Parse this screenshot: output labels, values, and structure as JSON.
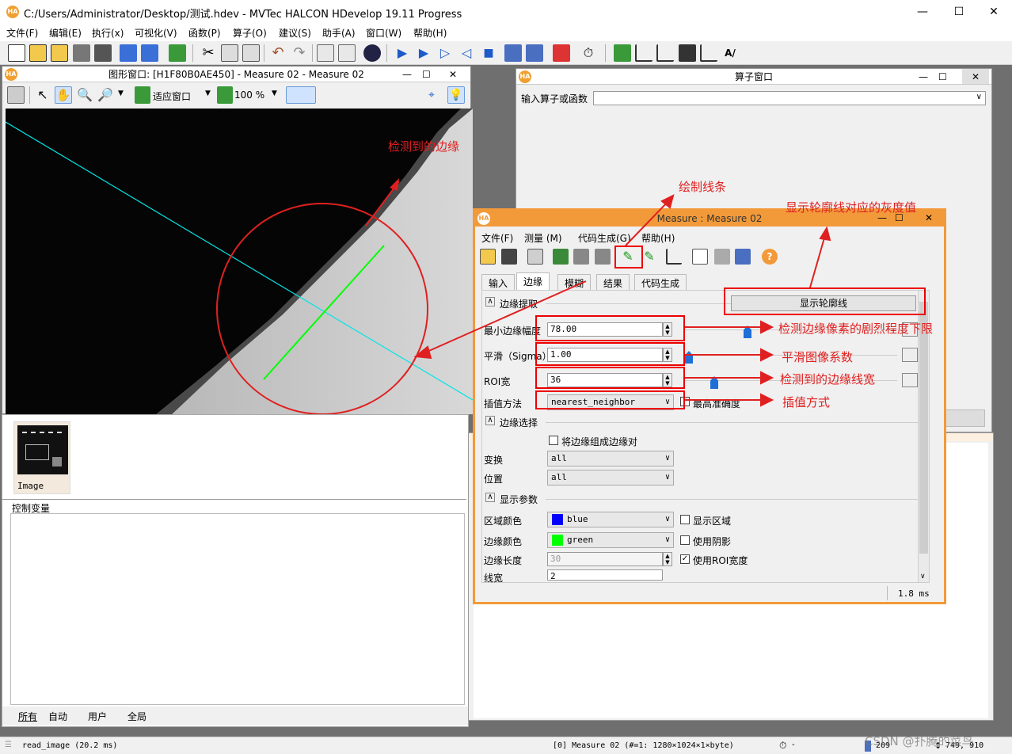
{
  "window": {
    "title": "C:/Users/Administrator/Desktop/测试.hdev - MVTec HALCON HDevelop 19.11 Progress",
    "icon": "HA"
  },
  "menu": [
    "文件(F)",
    "编辑(E)",
    "执行(x)",
    "可视化(V)",
    "函数(P)",
    "算子(O)",
    "建议(S)",
    "助手(A)",
    "窗口(W)",
    "帮助(H)"
  ],
  "graphics": {
    "title": "图形窗口: [H1F80B0AE450] - Measure 02 - Measure 02",
    "fit_label": "适应窗口",
    "zoom_label": "100 %"
  },
  "variables": {
    "image_label": "Image",
    "control_title": "控制变量",
    "tabs": [
      "所有",
      "自动",
      "用户",
      "全局"
    ]
  },
  "operator_window": {
    "title": "算子窗口",
    "input_label": "输入算子或函数"
  },
  "measure": {
    "title": "Measure : Measure 02",
    "menu": [
      "文件(F)",
      "测量 (M)",
      "代码生成(G)",
      "帮助(H)"
    ],
    "tabs": [
      "输入",
      "边缘",
      "模糊",
      "结果",
      "代码生成"
    ],
    "section_extract": "边缘提取",
    "show_contour_btn": "显示轮廓线",
    "min_amp_label": "最小边缘幅度",
    "min_amp_value": "78.00",
    "sigma_label": "平滑（Sigma）",
    "sigma_value": "1.00",
    "roi_label": "ROI宽",
    "roi_value": "36",
    "interp_label": "插值方法",
    "interp_value": "nearest_neighbor",
    "max_precision_label": "最高准确度",
    "section_select": "边缘选择",
    "pair_label": "将边缘组成边缘对",
    "transform_label": "变换",
    "transform_value": "all",
    "position_label": "位置",
    "position_value": "all",
    "section_display": "显示参数",
    "region_color_label": "区域颜色",
    "region_color_value": "blue",
    "show_region_label": "显示区域",
    "edge_color_label": "边缘颜色",
    "edge_color_value": "green",
    "shadow_label": "使用阴影",
    "edge_length_label": "边缘长度",
    "edge_length_value": "30",
    "use_roi_width_label": "使用ROI宽度",
    "line_width_label": "线宽",
    "line_width_value": "2",
    "timing": "1.8 ms"
  },
  "annotations": {
    "detected_edge": "检测到的边缘",
    "draw_line": "绘制线条",
    "show_gray": "显示轮廓线对应的灰度值",
    "min_amp": "检测边缘像素的剧烈程度下限",
    "smooth": "平滑图像系数",
    "edge_width": "检测到的边缘线宽",
    "interp": "插值方式"
  },
  "status": {
    "left": "read_image (20.2 ms)",
    "middle": "[0] Measure 02 (#=1: 1280×1024×1×byte)",
    "right_num": "209",
    "coords": "749, 910",
    "watermark": "CSDN @扑腾的菜鸟"
  },
  "colors": {
    "accent": "#f29a3a",
    "annotation": "#e02020",
    "blue": "#0000ff",
    "green": "#00ff00",
    "cyan": "#00e5e5"
  }
}
